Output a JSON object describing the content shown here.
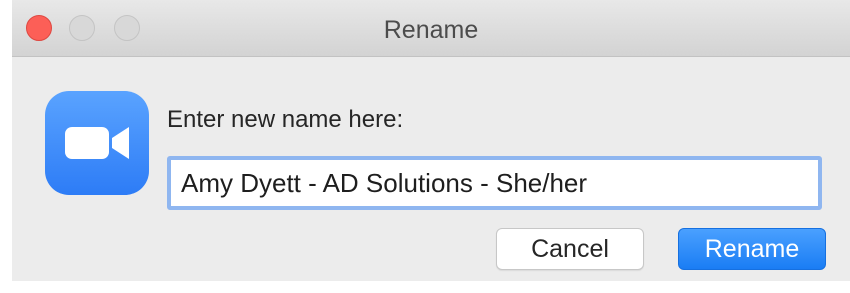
{
  "window": {
    "title": "Rename",
    "traffic_lights": [
      "close",
      "minimize",
      "zoom"
    ]
  },
  "dialog": {
    "icon": "zoom-video-camera-icon",
    "prompt": "Enter new name here:",
    "input_value": "Amy Dyett - AD Solutions - She/her"
  },
  "buttons": {
    "cancel_label": "Cancel",
    "rename_label": "Rename"
  },
  "colors": {
    "accent": "#2d7cf6",
    "close": "#fc5f57"
  }
}
